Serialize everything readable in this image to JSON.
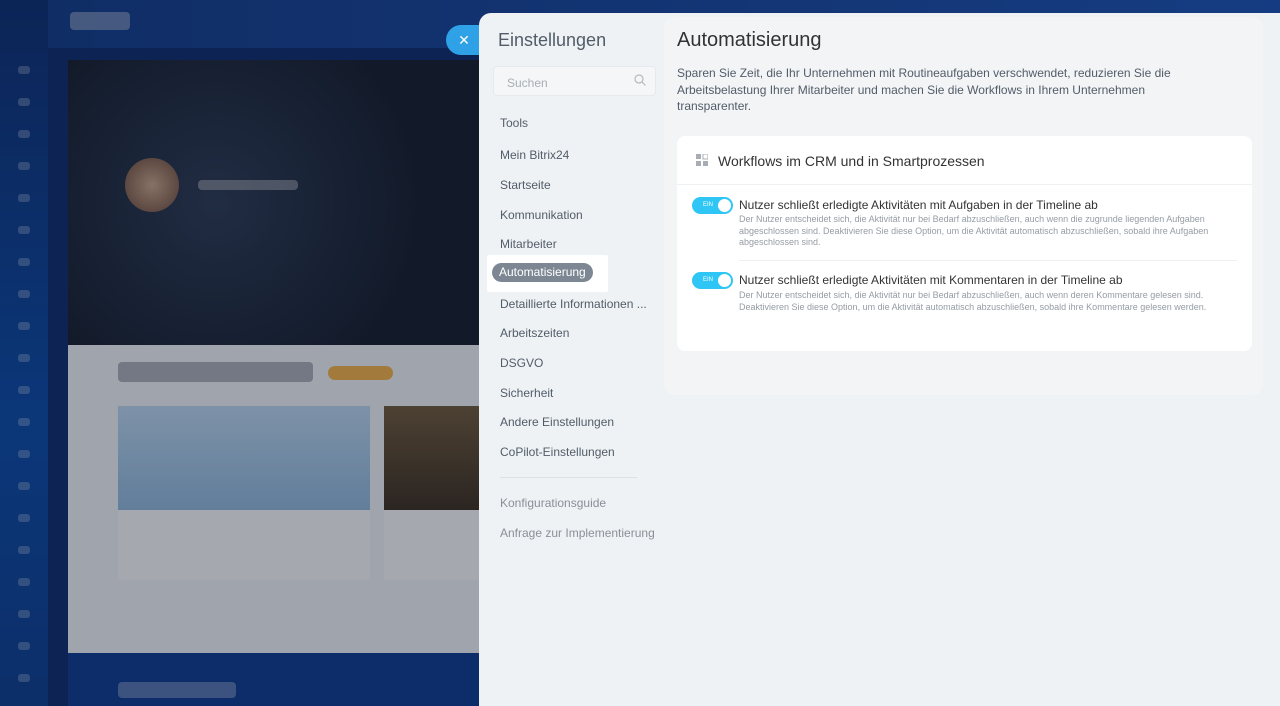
{
  "sidebar": {
    "title": "Einstellungen",
    "search_placeholder": "Suchen",
    "items": [
      "Tools",
      "Mein Bitrix24",
      "Startseite",
      "Kommunikation",
      "Mitarbeiter",
      "Automatisierung",
      "Detaillierte Informationen ...",
      "Arbeitszeiten",
      "DSGVO",
      "Sicherheit",
      "Andere Einstellungen",
      "CoPilot-Einstellungen"
    ],
    "active_item": "Automatisierung",
    "footer_items": [
      "Konfigurationsguide",
      "Anfrage zur Implementierung"
    ]
  },
  "content": {
    "title": "Automatisierung",
    "description": "Sparen Sie Zeit, die Ihr Unternehmen mit Routineaufgaben verschwendet, reduzieren Sie die Arbeitsbelastung Ihrer Mitarbeiter und machen Sie die Workflows in Ihrem Unternehmen transparenter.",
    "section_title": "Workflows im CRM und in Smartprozessen",
    "options": [
      {
        "title": "Nutzer schließt erledigte Aktivitäten mit Aufgaben in der Timeline ab",
        "description": "Der Nutzer entscheidet sich, die Aktivität nur bei Bedarf abzuschließen, auch wenn die zugrunde liegenden Aufgaben abgeschlossen sind. Deaktivieren Sie diese Option, um die Aktivität automatisch abzuschließen, sobald ihre Aufgaben abgeschlossen sind.",
        "toggle_label": "EIN",
        "enabled": true
      },
      {
        "title": "Nutzer schließt erledigte Aktivitäten mit Kommentaren in der Timeline ab",
        "description": "Der Nutzer entscheidet sich, die Aktivität nur bei Bedarf abzuschließen, auch wenn deren Kommentare gelesen sind. Deaktivieren Sie diese Option, um die Aktivität automatisch abzuschließen, sobald ihre Kommentare gelesen werden.",
        "toggle_label": "EIN",
        "enabled": true
      }
    ]
  },
  "colors": {
    "accent": "#2fc6f6",
    "close_button": "#2fa1e6",
    "active_item": "#7d8793"
  },
  "icons": {
    "close": "close-icon",
    "search": "search-icon",
    "section": "grid-icon"
  }
}
